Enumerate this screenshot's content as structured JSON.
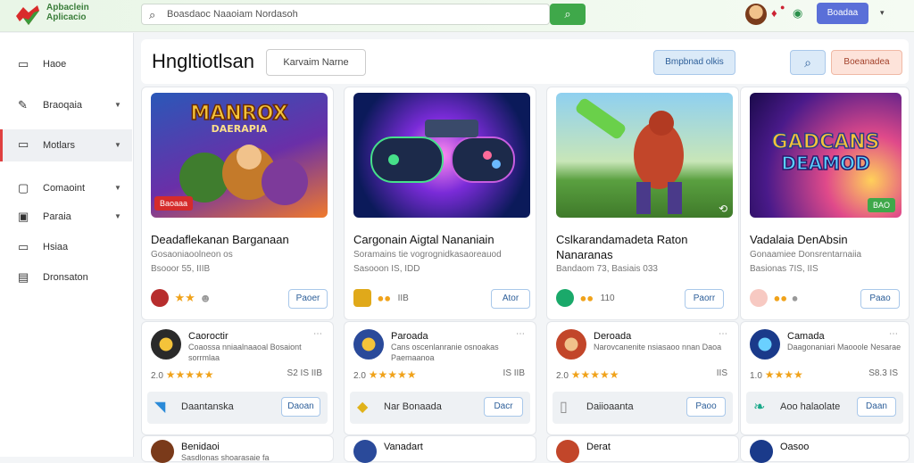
{
  "brand": {
    "line1": "Apbaclein",
    "line2": "Aplicacio"
  },
  "search": {
    "placeholder": "Boasdaoc Naaoiam Nordasoh"
  },
  "topbar": {
    "signin": "Boadaa",
    "caret": "▾"
  },
  "sidebar": {
    "items": [
      {
        "label": "Haoe",
        "icon": "home-icon",
        "chevron": false
      },
      {
        "label": "Braoqaia",
        "icon": "tool-icon",
        "chevron": true
      },
      {
        "label": "Motlars",
        "icon": "folder-icon",
        "chevron": true,
        "active": true
      },
      {
        "label": "Comaoint",
        "icon": "calendar-icon",
        "chevron": true
      },
      {
        "label": "Paraia",
        "icon": "grid-icon",
        "chevron": true
      },
      {
        "label": "Hsiaa",
        "icon": "box-icon",
        "chevron": false
      },
      {
        "label": "Dronsaton",
        "icon": "list-icon",
        "chevron": false
      }
    ]
  },
  "header": {
    "title": "Hngltiotlsan",
    "select": "Karvaim Narne",
    "btn1": "Bmpbnad olkis",
    "btn3": "Boeanadea"
  },
  "cards": [
    {
      "title": "Deadaflekanan Barganaan",
      "sub": "Gosaoniaoolneon os",
      "meta": "Bsooor 55, IIIB",
      "badge": "Baoaaa",
      "rating": "",
      "button": "Paoer",
      "thumb_text": "MANROX",
      "thumb_sub": "DAERAPIA"
    },
    {
      "title": "Cargonain Aigtal Nananiain",
      "sub": "Soramains tie vogrognidkasaoreauod",
      "meta": "Sasooon IS, IDD",
      "badge": "",
      "rating": "IIB",
      "button": "Ator",
      "thumb_text": "",
      "thumb_sub": ""
    },
    {
      "title": "Cslkarandamadeta Raton Nanaranas",
      "sub": "",
      "meta": "Bandaom 73, Basiais 033",
      "badge": "",
      "rating": "110",
      "button": "Paorr",
      "thumb_text": "",
      "thumb_sub": ""
    },
    {
      "title": "Vadalaia DenAbsin",
      "sub": "Gonaamiee Donsrentarnaiia",
      "meta": "Basionas 7IS, IIS",
      "badge": "BAO",
      "rating": "",
      "button": "Paao",
      "thumb_text": "GADCANS",
      "thumb_sub": "DEAMOD"
    }
  ],
  "subs": [
    {
      "title": "Caoroctir",
      "desc": "Coaossa nniaalnaaoal Bosaiont sorrmlaa",
      "rating": "2.0",
      "right": "S2 IS IIB",
      "foot": "Daantanska",
      "button": "Daoan"
    },
    {
      "title": "Paroada",
      "desc": "Cans oscenlanranie osnoakas Paemaanoa",
      "rating": "2.0",
      "right": "IS IIB",
      "foot": "Nar Bonaada",
      "button": "Dacr"
    },
    {
      "title": "Deroada",
      "desc": "Narovcanenite nsiasaoo nnan Daoa",
      "rating": "2.0",
      "right": "IIS",
      "foot": "Daiioaanta",
      "button": "Paoo"
    },
    {
      "title": "Camada",
      "desc": "Daagonaniari Maooole Nesarae",
      "rating": "1.0",
      "right": "S8.3 IS",
      "foot": "Aoo halaolate",
      "button": "Daan"
    }
  ],
  "peeks": [
    {
      "title": "Benidaoi",
      "desc": "Sasdlonas shoarasaie fa"
    },
    {
      "title": "Vanadart",
      "desc": ""
    },
    {
      "title": "Derat",
      "desc": ""
    },
    {
      "title": "Oasoo",
      "desc": ""
    }
  ]
}
